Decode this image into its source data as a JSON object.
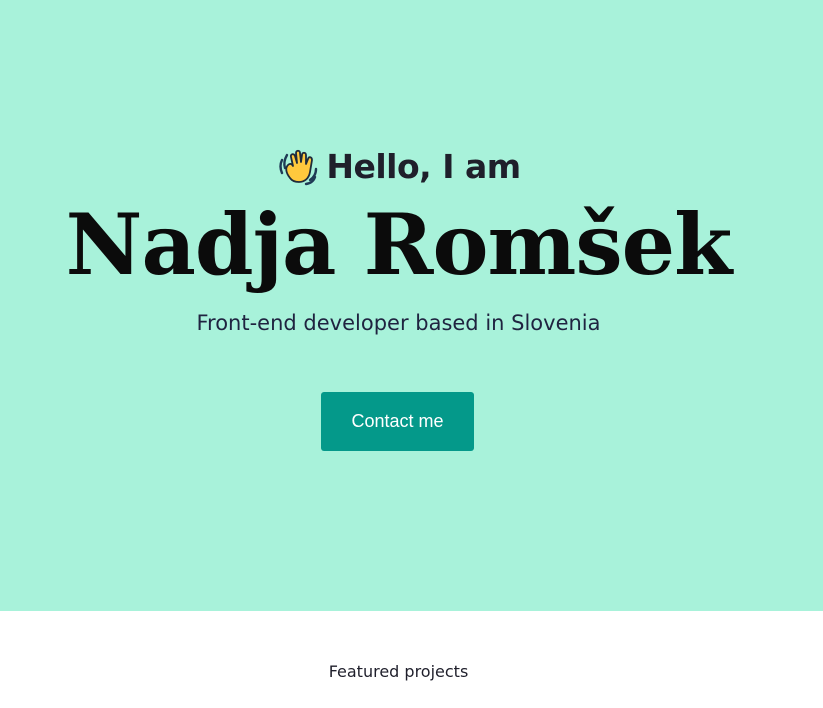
{
  "hero": {
    "background": "#a8f2da",
    "wave_icon": "waving-hand-icon",
    "greeting": "Hello, I am",
    "name": "Nadja Romšek",
    "subtitle": "Front-end developer based in Slovenia",
    "contact_label": "Contact me",
    "button_color": "#04998a"
  },
  "featured": {
    "heading": "Featured projects"
  }
}
